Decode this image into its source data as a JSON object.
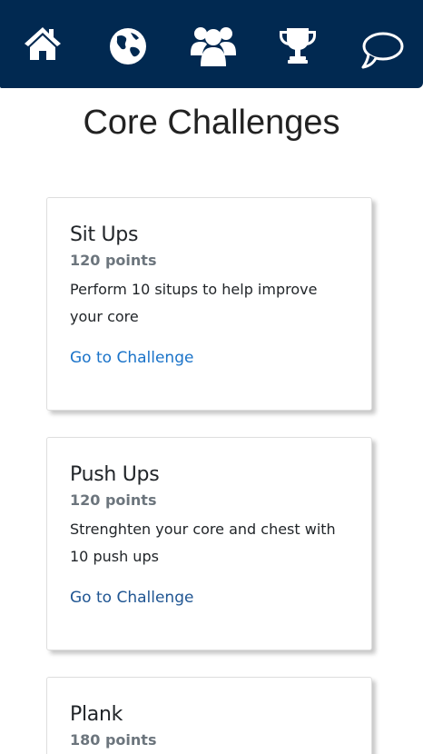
{
  "nav": {
    "items": [
      {
        "icon": "home-icon",
        "label": ""
      },
      {
        "icon": "globe-icon",
        "label": ""
      },
      {
        "icon": "users-icon",
        "label": ""
      },
      {
        "icon": "trophy-icon",
        "label": ""
      },
      {
        "icon": "chat-icon",
        "label": ""
      }
    ],
    "background": "#012951",
    "icon_color": "#ffffff"
  },
  "page": {
    "title": "Core Challenges"
  },
  "challenges": [
    {
      "title": "Sit Ups",
      "points": "120 points",
      "description": "Perform 10 situps to help improve your core",
      "link": "Go to Challenge"
    },
    {
      "title": "Push Ups",
      "points": "120 points",
      "description": "Strenghten your core and chest with 10 push ups",
      "link": "Go to Challenge"
    },
    {
      "title": "Plank",
      "points": "180 points",
      "description": "",
      "link": ""
    }
  ],
  "colors": {
    "link": "#1a73c9",
    "points": "#6c757d"
  }
}
